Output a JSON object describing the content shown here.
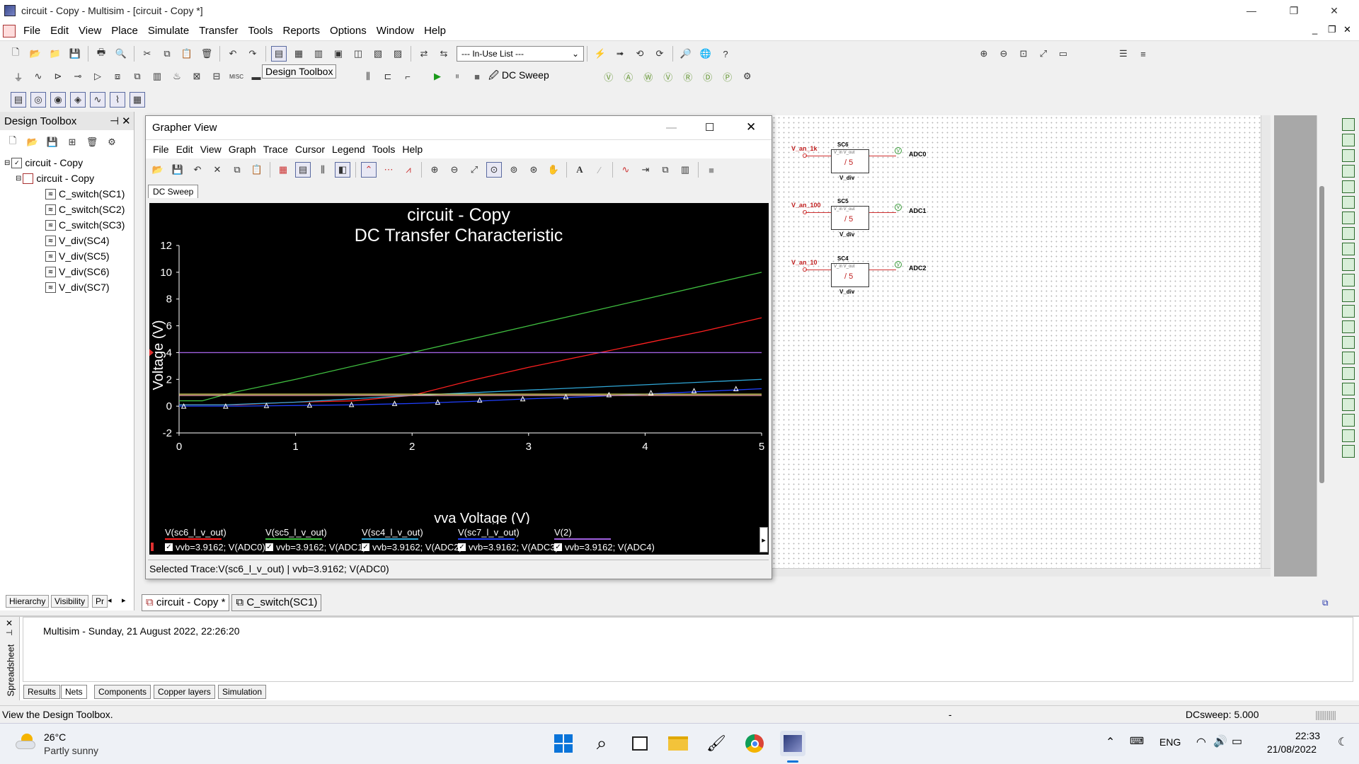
{
  "window": {
    "title": "circuit - Copy - Multisim - [circuit - Copy *]",
    "minimize": "—",
    "restore": "❐",
    "close": "✕"
  },
  "menu": [
    "File",
    "Edit",
    "View",
    "Place",
    "Simulate",
    "Transfer",
    "Tools",
    "Reports",
    "Options",
    "Window",
    "Help"
  ],
  "doc_controls": [
    "_",
    "❐",
    "✕"
  ],
  "toolbar": {
    "inuse_list": "--- In-Use List ---",
    "tooltip": "Design Toolbox",
    "analysis": "DC Sweep",
    "misc_label": "MISC"
  },
  "design_toolbox": {
    "title": "Design Toolbox",
    "root": "circuit - Copy",
    "sheet": "circuit - Copy",
    "items": [
      "C_switch(SC1)",
      "C_switch(SC2)",
      "C_switch(SC3)",
      "V_div(SC4)",
      "V_div(SC5)",
      "V_div(SC6)",
      "V_div(SC7)"
    ],
    "tabs": [
      "Hierarchy",
      "Visibility",
      "Pr"
    ]
  },
  "grapher": {
    "title": "Grapher View",
    "menu": [
      "File",
      "Edit",
      "View",
      "Graph",
      "Trace",
      "Cursor",
      "Legend",
      "Tools",
      "Help"
    ],
    "tab": "DC Sweep",
    "status": "Selected Trace:V(sc6_l_v_out) | vvb=3.9162; V(ADC0)"
  },
  "chart_data": {
    "type": "line",
    "title": "circuit - Copy",
    "subtitle": "DC Transfer Characteristic",
    "xlabel": "vva Voltage (V)",
    "ylabel": "Voltage (V)",
    "xlim": [
      0,
      5
    ],
    "ylim": [
      -2,
      12
    ],
    "x_ticks": [
      "0",
      "1",
      "2",
      "3",
      "4",
      "5"
    ],
    "y_ticks": [
      "12",
      "10",
      "8",
      "6",
      "4",
      "2",
      "0",
      "-2"
    ],
    "grid": false,
    "legend_placement": "bottom",
    "series": [
      {
        "name": "V(sc6_l_v_out)",
        "value_label": "vvb=3.9162; V(ADC0)",
        "color": "#ff2020",
        "points": [
          [
            0,
            0.1
          ],
          [
            0.5,
            0.1
          ],
          [
            1.0,
            0.3
          ],
          [
            1.5,
            0.4
          ],
          [
            2.0,
            0.8
          ],
          [
            2.5,
            1.9
          ],
          [
            3.0,
            2.9
          ],
          [
            3.5,
            3.8
          ],
          [
            4.0,
            4.7
          ],
          [
            4.5,
            5.6
          ],
          [
            5.0,
            6.6
          ]
        ]
      },
      {
        "name": "V(sc5_l_v_out)",
        "value_label": "vvb=3.9162; V(ADC1)",
        "color": "#40c040",
        "points": [
          [
            0,
            0.4
          ],
          [
            0.2,
            0.4
          ],
          [
            0.45,
            1.0
          ],
          [
            1.0,
            2.0
          ],
          [
            2.0,
            4.0
          ],
          [
            3.0,
            6.0
          ],
          [
            4.0,
            8.0
          ],
          [
            5.0,
            10.0
          ]
        ]
      },
      {
        "name": "V(sc4_l_v_out)",
        "value_label": "vvb=3.9162; V(ADC2)",
        "color": "#30a8d8",
        "points": [
          [
            0,
            0.1
          ],
          [
            0.4,
            0.1
          ],
          [
            1.0,
            0.3
          ],
          [
            2.0,
            0.8
          ],
          [
            3.0,
            1.2
          ],
          [
            4.0,
            1.6
          ],
          [
            5.0,
            2.0
          ]
        ]
      },
      {
        "name": "V(sc7_l_v_out)",
        "value_label": "vvb=3.9162; V(ADC3)",
        "color": "#2040ff",
        "points": [
          [
            0,
            0.0
          ],
          [
            0.5,
            0.0
          ],
          [
            1.0,
            0.05
          ],
          [
            1.5,
            0.1
          ],
          [
            2.0,
            0.2
          ],
          [
            2.5,
            0.35
          ],
          [
            3.0,
            0.55
          ],
          [
            3.5,
            0.7
          ],
          [
            4.0,
            0.9
          ],
          [
            4.5,
            1.1
          ],
          [
            5.0,
            1.3
          ]
        ]
      },
      {
        "name": "V(2)",
        "value_label": "vvb=3.9162; V(ADC4)",
        "color": "#a060e0",
        "points": [
          [
            0,
            4.0
          ],
          [
            5.0,
            4.0
          ]
        ]
      },
      {
        "name": "",
        "value_label": "",
        "color": "#ffb0b0",
        "points": [
          [
            0,
            0.8
          ],
          [
            5.0,
            0.8
          ]
        ]
      },
      {
        "name": "",
        "value_label": "",
        "color": "#e0e060",
        "points": [
          [
            0,
            0.9
          ],
          [
            5.0,
            0.9
          ]
        ]
      }
    ],
    "markers": [
      [
        0.04,
        0.0
      ],
      [
        0.4,
        0.0
      ],
      [
        0.75,
        0.05
      ],
      [
        1.12,
        0.08
      ],
      [
        1.48,
        0.12
      ],
      [
        1.85,
        0.2
      ],
      [
        2.22,
        0.3
      ],
      [
        2.58,
        0.45
      ],
      [
        2.95,
        0.55
      ],
      [
        3.32,
        0.7
      ],
      [
        3.69,
        0.85
      ],
      [
        4.05,
        1.0
      ],
      [
        4.42,
        1.15
      ],
      [
        4.78,
        1.3
      ]
    ]
  },
  "schematic": {
    "blocks": [
      {
        "ref": "SC6",
        "input": "V_an_1k",
        "output": "ADC0",
        "label": "V_div",
        "value": "/ 5"
      },
      {
        "ref": "SC5",
        "input": "V_an_100",
        "output": "ADC1",
        "label": "V_div",
        "value": "/ 5"
      },
      {
        "ref": "SC4",
        "input": "V_an_10",
        "output": "ADC2",
        "label": "V_div",
        "value": "/ 5"
      }
    ],
    "pins": "V_in  V_out"
  },
  "doc_tabs": [
    "circuit - Copy *",
    "C_switch(SC1)"
  ],
  "spreadsheet": {
    "side_label": "Spreadsheet",
    "log": "Multisim  -  Sunday, 21 August 2022, 22:26:20",
    "tabs": [
      "Results",
      "Nets",
      "Components",
      "Copper layers",
      "Simulation"
    ]
  },
  "status": {
    "left": "View the Design Toolbox.",
    "mid": "-",
    "right": "DCsweep: 5.000"
  },
  "taskbar": {
    "temp": "26°C",
    "weather": "Partly sunny",
    "lang": "ENG",
    "time": "22:33",
    "date": "21/08/2022"
  }
}
